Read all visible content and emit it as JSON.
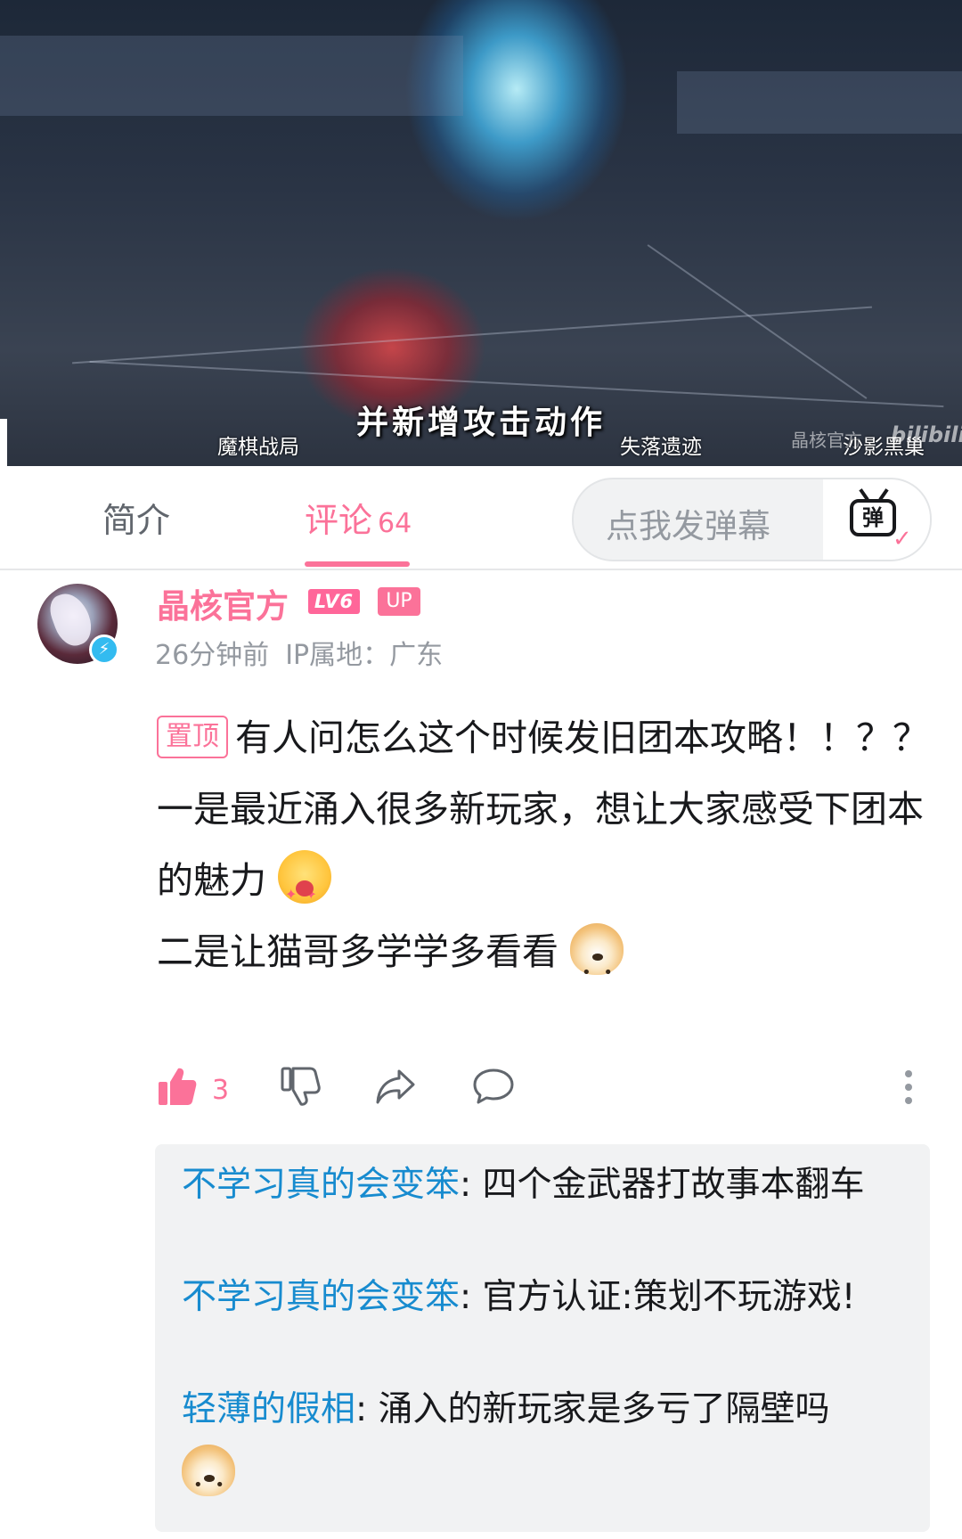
{
  "video": {
    "caption": "并新增攻击动作",
    "locations": [
      "魔棋战局",
      "失落遗迹",
      "沙影黑巢"
    ],
    "watermark": "晶核官方",
    "watermark_logo": "bilibili"
  },
  "tabs": {
    "intro": "简介",
    "comments": "评论",
    "comments_count": "64"
  },
  "danmaku": {
    "placeholder": "点我发弹幕",
    "button_glyph": "弹"
  },
  "comment": {
    "username": "晶核官方",
    "level": "LV6",
    "up_badge": "UP",
    "time": "26分钟前",
    "ip": "IP属地：广东",
    "pinned_label": "置顶",
    "lines": [
      "有人问怎么这个时候发旧团本攻略！！？？",
      "一是最近涌入很多新玩家，想让大家感受下团本的魅力",
      "二是让猫哥多学学多看看"
    ],
    "like_count": "3"
  },
  "replies": [
    {
      "name": "不学习真的会变笨",
      "text": ": 四个金武器打故事本翻车"
    },
    {
      "name": "不学习真的会变笨",
      "text": ": 官方认证:策划不玩游戏!"
    },
    {
      "name": "轻薄的假相",
      "text": ": 涌入的新玩家是多亏了隔壁吗"
    }
  ],
  "colors": {
    "accent_pink": "#fb7299",
    "reply_name_blue": "#178bcf",
    "text_gray": "#9499a0"
  },
  "icons": [
    "verified-bolt-icon",
    "thumbs-up-icon",
    "thumbs-down-icon",
    "share-icon",
    "reply-bubble-icon",
    "more-vertical-icon",
    "danmaku-tv-icon",
    "wow-face-emoji",
    "doge-emoji"
  ]
}
